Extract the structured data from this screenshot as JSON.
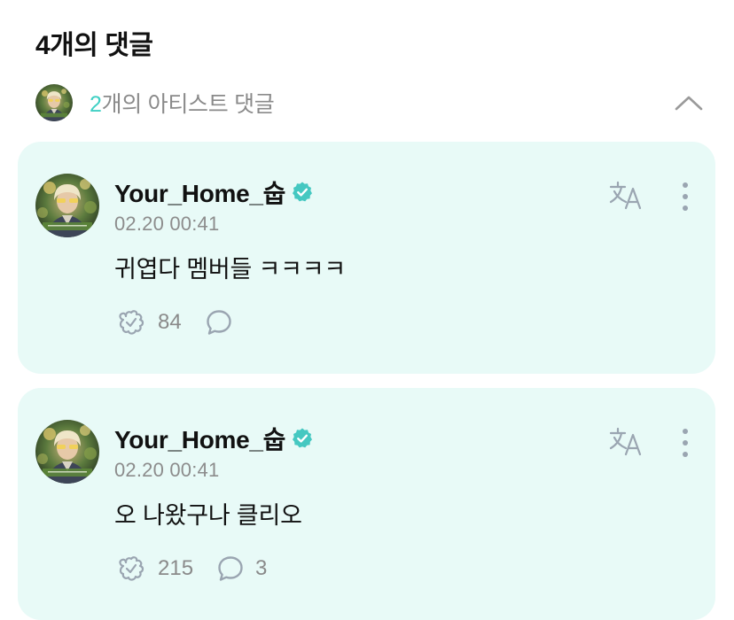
{
  "header": {
    "title": "4개의 댓글"
  },
  "artist_comments": {
    "count": "2",
    "label": "개의 아티스트 댓글",
    "avatar_icon": "artist-avatar",
    "toggle_icon": "chevron-up-icon"
  },
  "colors": {
    "accent": "#3fd0c4",
    "card_bg": "#e8faf7",
    "muted": "#8a8a8a"
  },
  "comments": [
    {
      "author": "Your_Home_숩",
      "verified": true,
      "timestamp": "02.20 00:41",
      "text": "귀엽다 멤버들 ㅋㅋㅋㅋ",
      "likes": "84",
      "replies": "",
      "icons": [
        "avatar",
        "verified-badge-icon",
        "translate-icon",
        "more-options-icon",
        "like-icon",
        "reply-icon"
      ]
    },
    {
      "author": "Your_Home_숩",
      "verified": true,
      "timestamp": "02.20 00:41",
      "text": "오 나왔구나 클리오",
      "likes": "215",
      "replies": "3",
      "icons": [
        "avatar",
        "verified-badge-icon",
        "translate-icon",
        "more-options-icon",
        "like-icon",
        "reply-icon"
      ]
    }
  ]
}
